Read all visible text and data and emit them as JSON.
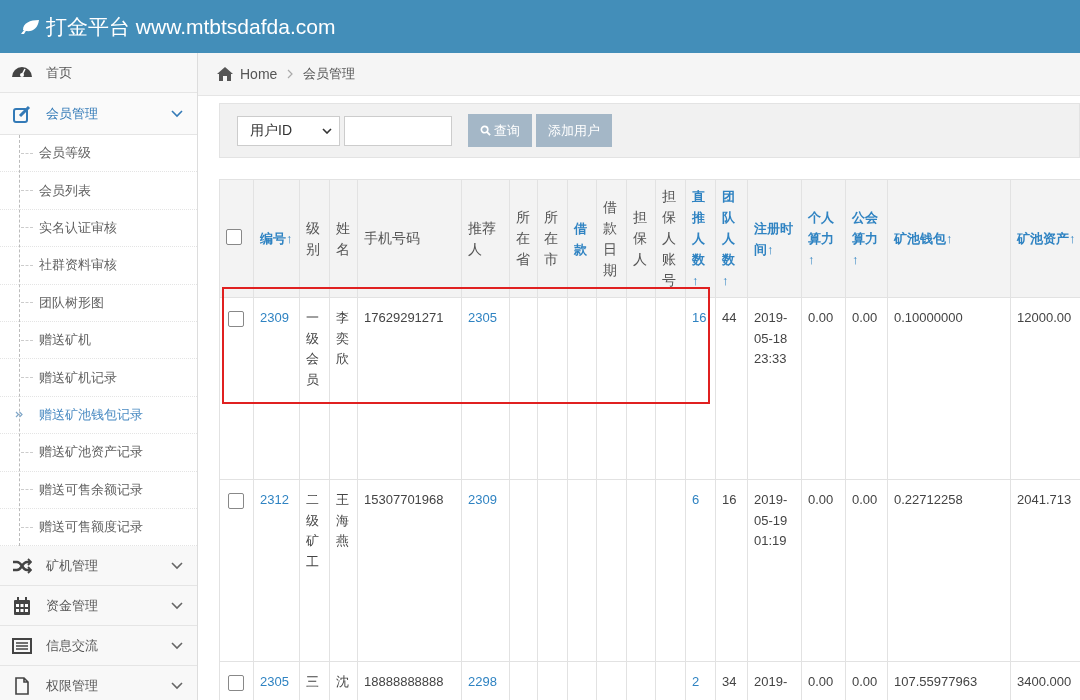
{
  "header": {
    "brand": "打金平台 www.mtbtsdafda.com"
  },
  "sidebar": {
    "items": [
      {
        "label": "首页",
        "expanded": false
      },
      {
        "label": "会员管理",
        "expanded": true,
        "children": [
          {
            "label": "会员等级",
            "selected": false
          },
          {
            "label": "会员列表",
            "selected": false
          },
          {
            "label": "实名认证审核",
            "selected": false
          },
          {
            "label": "社群资料审核",
            "selected": false
          },
          {
            "label": "团队树形图",
            "selected": false
          },
          {
            "label": "赠送矿机",
            "selected": false
          },
          {
            "label": "赠送矿机记录",
            "selected": false
          },
          {
            "label": "赠送矿池钱包记录",
            "selected": true
          },
          {
            "label": "赠送矿池资产记录",
            "selected": false
          },
          {
            "label": "赠送可售余额记录",
            "selected": false
          },
          {
            "label": "赠送可售额度记录",
            "selected": false
          }
        ]
      },
      {
        "label": "矿机管理",
        "expanded": false
      },
      {
        "label": "资金管理",
        "expanded": false
      },
      {
        "label": "信息交流",
        "expanded": false
      },
      {
        "label": "权限管理",
        "expanded": false
      }
    ]
  },
  "breadcrumb": [
    "Home",
    "会员管理"
  ],
  "search": {
    "select": "用户ID",
    "query_button": "查询",
    "add_button": "添加用户"
  },
  "table": {
    "select_all": {
      "checked": false
    },
    "columns": [
      {
        "label": "编号↑",
        "sortable": true,
        "kind": "link"
      },
      {
        "label": "级别",
        "sortable": false,
        "kind": "text"
      },
      {
        "label": "姓名",
        "sortable": false,
        "kind": "text"
      },
      {
        "label": "手机号码",
        "sortable": false,
        "kind": "text"
      },
      {
        "label": "推荐人",
        "sortable": false,
        "kind": "link"
      },
      {
        "label": "所在省",
        "sortable": false
      },
      {
        "label": "所在市",
        "sortable": false
      },
      {
        "label": "借款",
        "sortable": true
      },
      {
        "label": "借款日期",
        "sortable": false
      },
      {
        "label": "担保人",
        "sortable": false
      },
      {
        "label": "担保人账号",
        "sortable": false
      },
      {
        "label": "直推人数↑",
        "sortable": true,
        "kind": "link"
      },
      {
        "label": "团队人数↑",
        "sortable": true,
        "kind": "text"
      },
      {
        "label": "注册时间↑",
        "sortable": true,
        "kind": "text"
      },
      {
        "label": "个人算力↑",
        "sortable": true,
        "kind": "text"
      },
      {
        "label": "公会算力↑",
        "sortable": true,
        "kind": "text"
      },
      {
        "label": "矿池钱包↑",
        "sortable": true,
        "kind": "text"
      },
      {
        "label": "矿池资产↑",
        "sortable": true,
        "kind": "text"
      }
    ],
    "rows": [
      {
        "checked": false,
        "highlighted": true,
        "cells": [
          "2309",
          "一级会员",
          "李奕欣",
          "17629291271",
          "2305",
          "",
          "",
          "",
          "",
          "",
          "",
          "16",
          "44",
          "2019-05-18 23:33",
          "0.00",
          "0.00",
          "0.10000000",
          "12000.00"
        ]
      },
      {
        "checked": false,
        "highlighted": false,
        "cells": [
          "2312",
          "二级矿工",
          "王海燕",
          "15307701968",
          "2309",
          "",
          "",
          "",
          "",
          "",
          "",
          "6",
          "16",
          "2019-05-19 01:19",
          "0.00",
          "0.00",
          "0.22712258",
          "2041.713"
        ]
      },
      {
        "checked": false,
        "highlighted": false,
        "cells": [
          "2305",
          "三",
          "沈",
          "18888888888",
          "2298",
          "",
          "",
          "",
          "",
          "",
          "",
          "2",
          "34",
          "2019-",
          "0.00",
          "0.00",
          "107.55977963",
          "3400.000"
        ]
      }
    ]
  }
}
